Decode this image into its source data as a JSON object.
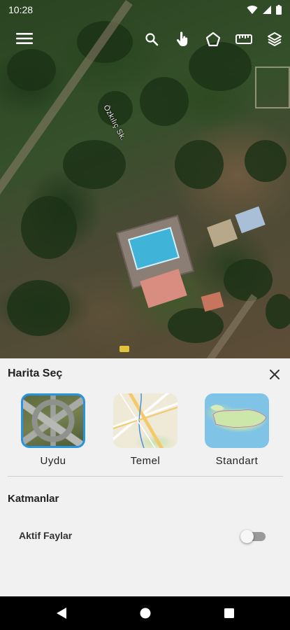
{
  "status_bar": {
    "time": "10:28",
    "icons": [
      "wifi-icon",
      "cellular-signal-icon",
      "battery-icon"
    ]
  },
  "map": {
    "street_label": "Özkılıç Sk.",
    "toolbar": {
      "left": "menu-icon",
      "right": [
        "search-icon",
        "touch-select-icon",
        "polygon-draw-icon",
        "ruler-measure-icon",
        "layers-icon"
      ]
    }
  },
  "sheet": {
    "title": "Harita Seç",
    "close_icon": "close-icon",
    "map_types": [
      {
        "label": "Uydu",
        "selected": true
      },
      {
        "label": "Temel",
        "selected": false
      },
      {
        "label": "Standart",
        "selected": false
      }
    ],
    "layers_title": "Katmanlar",
    "layers": [
      {
        "label": "Aktif Faylar",
        "enabled": false
      }
    ]
  },
  "colors": {
    "accent": "#2a93e0",
    "sheet_background": "#f1f1f1",
    "nav_bar": "#000000"
  },
  "nav_bar": {
    "buttons": [
      "back-icon",
      "home-icon",
      "recents-icon"
    ]
  }
}
